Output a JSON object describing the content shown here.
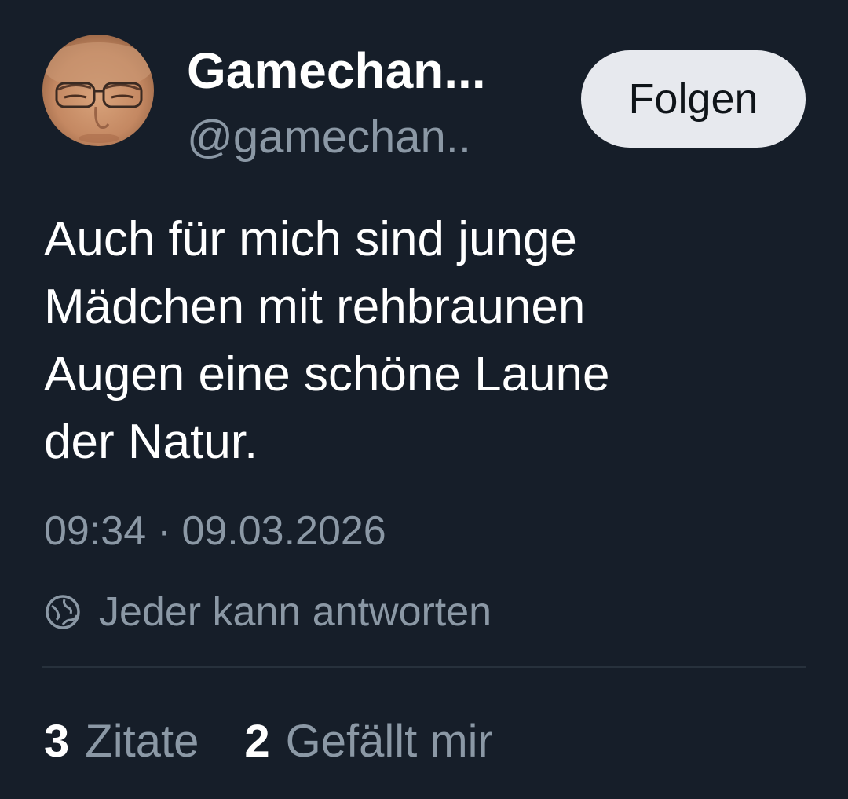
{
  "author": {
    "display_name": "Gamechan...",
    "handle": "@gamechan.."
  },
  "follow_button": {
    "label": "Folgen"
  },
  "tweet": {
    "lines": [
      "Auch für mich sind junge",
      "Mädchen mit rehbraunen",
      "Augen eine schöne Laune",
      "der Natur."
    ],
    "time": "09:34",
    "separator": "·",
    "date": "09.03.2026"
  },
  "reply_setting": {
    "icon": "globe-icon",
    "label": "Jeder kann antworten"
  },
  "stats": [
    {
      "count": "3",
      "label": "Zitate"
    },
    {
      "count": "2",
      "label": "Gefällt mir"
    }
  ],
  "colors": {
    "background": "#161e29",
    "text_primary": "#ffffff",
    "text_secondary": "#8b98a5",
    "button_background": "#e7e9ee",
    "divider": "#27313c"
  }
}
